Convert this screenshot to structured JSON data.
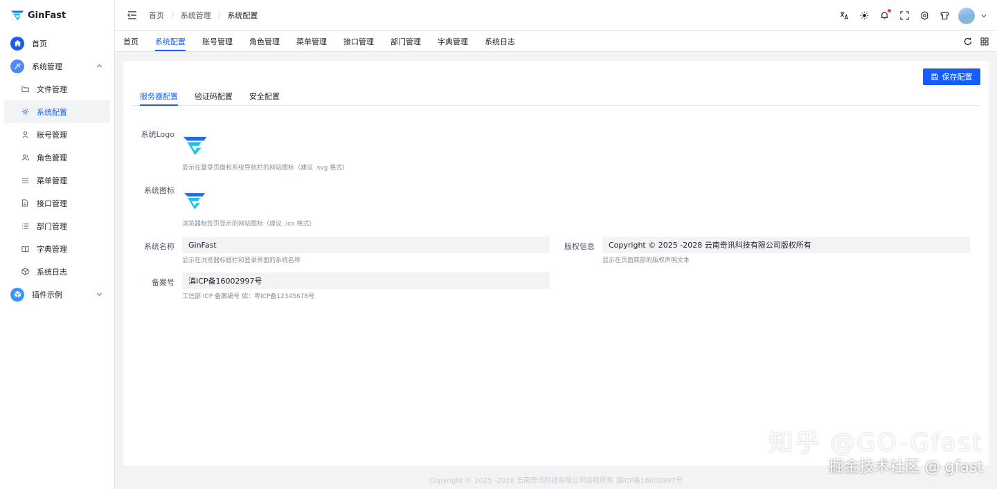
{
  "app": {
    "name": "GinFast"
  },
  "sidebar": {
    "items": [
      {
        "label": "首页",
        "icon": "home-icon"
      },
      {
        "label": "系统管理",
        "icon": "tools-icon",
        "expanded": true
      },
      {
        "label": "文件管理",
        "icon": "folder-icon"
      },
      {
        "label": "系统配置",
        "icon": "gear-icon",
        "active": true
      },
      {
        "label": "账号管理",
        "icon": "user-icon"
      },
      {
        "label": "角色管理",
        "icon": "users-icon"
      },
      {
        "label": "菜单管理",
        "icon": "menu-icon"
      },
      {
        "label": "接口管理",
        "icon": "file-icon"
      },
      {
        "label": "部门管理",
        "icon": "list-icon"
      },
      {
        "label": "字典管理",
        "icon": "book-icon"
      },
      {
        "label": "系统日志",
        "icon": "cube-icon"
      },
      {
        "label": "插件示例",
        "icon": "plugin-icon",
        "expanded": false
      }
    ]
  },
  "header": {
    "breadcrumb": [
      "首页",
      "系统管理",
      "系统配置"
    ],
    "separator": "/"
  },
  "tabbar": {
    "tabs": [
      "首页",
      "系统配置",
      "账号管理",
      "角色管理",
      "菜单管理",
      "接口管理",
      "部门管理",
      "字典管理",
      "系统日志"
    ],
    "active_index": 1
  },
  "main": {
    "save_label": "保存配置",
    "inner_tabs": [
      "服务器配置",
      "验证码配置",
      "安全配置"
    ],
    "active_inner_tab": 0,
    "fields": {
      "logo_label": "系统Logo",
      "logo_help": "显示在登录页面和系统导航栏的网站图标（建议 .svg 格式）",
      "icon_label": "系统图标",
      "icon_help": "浏览器标签页显示的网站图标（建议 .ico 格式）",
      "name_label": "系统名称",
      "name_value": "GinFast",
      "name_help": "显示在浏览器标题栏和登录界面的系统名称",
      "copyright_label": "版权信息",
      "copyright_value": "Copyright © 2025 -2028  云南奇讯科技有限公司版权所有",
      "copyright_help": "显示在页面底部的版权声明文本",
      "icp_label": "备案号",
      "icp_value": "滇ICP备16002997号",
      "icp_help": "工信部 ICP 备案编号 如：粤ICP备12345678号"
    }
  },
  "footer": {
    "text": "Copyright © 2025 -2028  云南奇讯科技有限公司版权所有 滇ICP备16002997号"
  },
  "watermark": {
    "line1": "知乎 @GO-Gfast",
    "line2": "掘金技术社区 @ gfast"
  },
  "colors": {
    "primary": "#165dff",
    "logo_blue": "#1e6cf0",
    "logo_cyan": "#22c3e6"
  }
}
